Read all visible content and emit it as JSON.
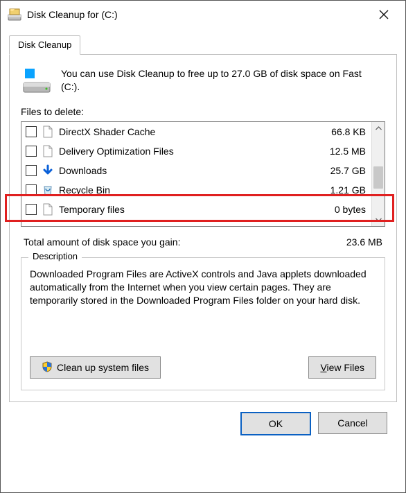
{
  "window": {
    "title": "Disk Cleanup for  (C:)"
  },
  "tab": {
    "label": "Disk Cleanup"
  },
  "intro": "You can use Disk Cleanup to free up to 27.0 GB of disk space on Fast (C:).",
  "files_label": "Files to delete:",
  "rows": [
    {
      "name": "DirectX Shader Cache",
      "size": "66.8 KB",
      "icon": "page"
    },
    {
      "name": "Delivery Optimization Files",
      "size": "12.5 MB",
      "icon": "page"
    },
    {
      "name": "Downloads",
      "size": "25.7 GB",
      "icon": "download"
    },
    {
      "name": "Recycle Bin",
      "size": "1.21 GB",
      "icon": "recycle"
    },
    {
      "name": "Temporary files",
      "size": "0 bytes",
      "icon": "page"
    }
  ],
  "total": {
    "label": "Total amount of disk space you gain:",
    "value": "23.6 MB"
  },
  "description": {
    "title": "Description",
    "body": "Downloaded Program Files are ActiveX controls and Java applets downloaded automatically from the Internet when you view certain pages. They are temporarily stored in the Downloaded Program Files folder on your hard disk."
  },
  "buttons": {
    "clean_system_pre": "",
    "clean_system": "Clean up system files",
    "view_files": "View Files",
    "ok": "OK",
    "cancel": "Cancel"
  }
}
